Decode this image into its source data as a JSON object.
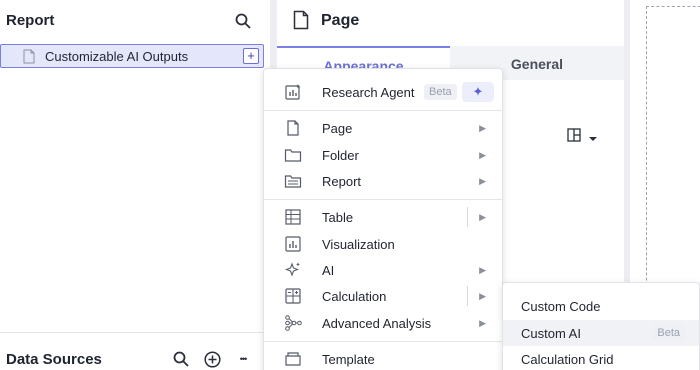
{
  "left_panel": {
    "title": "Report",
    "tree_item": "Customizable AI Outputs",
    "plus_symbol": "+",
    "bottom_title": "Data Sources",
    "more_symbol": "•••"
  },
  "mid_panel": {
    "title": "Page",
    "tabs": [
      "Appearance",
      "General"
    ]
  },
  "menu": {
    "research_agent": {
      "label": "Research Agent",
      "badge": "Beta",
      "spark": "✦"
    },
    "items": [
      "Page",
      "Folder",
      "Report",
      "Table",
      "Visualization",
      "AI",
      "Calculation",
      "Advanced Analysis",
      "Template"
    ],
    "chevron": "▶"
  },
  "submenu": {
    "items": [
      "Custom Code",
      "Custom AI",
      "Calculation Grid"
    ],
    "badge": "Beta"
  },
  "colors": {
    "accent": "#7b7fe0",
    "selected_bg": "#e4e7fb"
  }
}
